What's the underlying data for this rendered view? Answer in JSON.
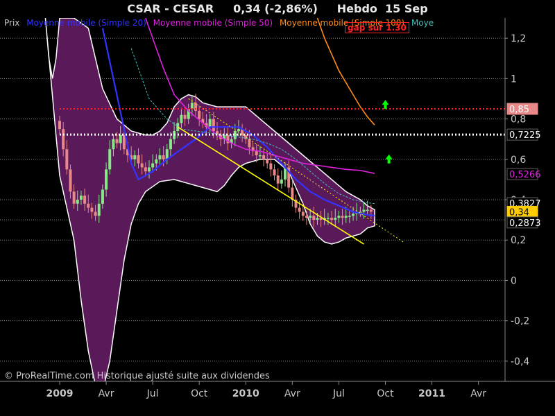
{
  "header": {
    "title": "CSAR - CESAR     0,34 (-2,86%)     Hebdo  15 Sep"
  },
  "legend": [
    {
      "label": "Prix",
      "color": "#c8c8c8"
    },
    {
      "label": "Moyenne mobile (Simple 20)",
      "color": "#3333ff"
    },
    {
      "label": "Moyenne mobile (Simple 50)",
      "color": "#dd22dd"
    },
    {
      "label": "Moyenne mobile (Simple 100)",
      "color": "#ff8c1a"
    },
    {
      "label": "Moye",
      "color": "#40c0c0"
    }
  ],
  "annotation": {
    "text": "gap sur 1.30",
    "color": "#ff2020"
  },
  "footer": {
    "text": "© ProRealTime.com Historique ajusté suite aux dividendes"
  },
  "colors": {
    "background": "#000000",
    "band_fill": "#5a1a5a",
    "band_edge": "#ffffff",
    "grid": "#8a8a8a",
    "axis_text": "#c8c8c8",
    "candle_up": "#88e888",
    "candle_down": "#e88888",
    "trend_line": "#ffff00",
    "resistance": "#ff2020",
    "support": "#ffffff",
    "arrow": "#00ff00"
  },
  "chart_data": {
    "type": "candlestick",
    "title": "CSAR - CESAR     0,34 (-2,86%)     Hebdo  15 Sep",
    "ylim": [
      -0.5,
      1.3
    ],
    "y_ticks": [
      "1,2",
      "1",
      "0,8",
      "0,6",
      "0,4",
      "0,2",
      "0",
      "-0,2",
      "-0,4"
    ],
    "y_tick_values": [
      1.2,
      1.0,
      0.8,
      0.6,
      0.4,
      0.2,
      0.0,
      -0.2,
      -0.4
    ],
    "x_ticks": [
      "2009",
      "Avr",
      "Jul",
      "Oct",
      "2010",
      "Avr",
      "Jul",
      "Oct",
      "2011",
      "Avr"
    ],
    "x_tick_bold": [
      true,
      false,
      false,
      false,
      true,
      false,
      false,
      false,
      true,
      false
    ],
    "x_range": [
      -4,
      116
    ],
    "x_tick_positions": [
      0,
      13,
      26,
      39,
      52,
      65,
      78,
      91,
      104,
      117
    ],
    "grid": true,
    "levels": [
      {
        "value": 0.85,
        "label": "0,85",
        "style": "dotted",
        "color": "#ff2020",
        "label_bg": "#e88888",
        "label_fg": "#ffffff"
      },
      {
        "value": 0.7225,
        "label": "0,7225",
        "style": "dotted",
        "color": "#ffffff",
        "label_bg": "#000000",
        "label_fg": "#ffffff"
      }
    ],
    "right_labels": [
      {
        "value": 0.5266,
        "label": "0,5266",
        "color": "#dd22dd",
        "bg": "#000000"
      },
      {
        "value": 0.3827,
        "label": "0,3827",
        "color": "#ffffff",
        "bg": "#000000"
      },
      {
        "value": 0.34,
        "label": "0,34",
        "color": "#000000",
        "bg": "#ffcc00"
      },
      {
        "value": 0.2873,
        "label": "0,2873",
        "color": "#ffffff",
        "bg": "#000000"
      }
    ],
    "close": [
      0.75,
      0.65,
      0.55,
      0.44,
      0.38,
      0.4,
      0.42,
      0.38,
      0.36,
      0.34,
      0.32,
      0.38,
      0.45,
      0.55,
      0.65,
      0.7,
      0.68,
      0.72,
      0.65,
      0.62,
      0.6,
      0.62,
      0.58,
      0.56,
      0.54,
      0.56,
      0.58,
      0.6,
      0.62,
      0.6,
      0.65,
      0.7,
      0.74,
      0.78,
      0.82,
      0.8,
      0.85,
      0.88,
      0.84,
      0.8,
      0.78,
      0.76,
      0.8,
      0.74,
      0.72,
      0.7,
      0.72,
      0.68,
      0.7,
      0.74,
      0.75,
      0.72,
      0.7,
      0.66,
      0.64,
      0.62,
      0.62,
      0.6,
      0.58,
      0.55,
      0.52,
      0.48,
      0.5,
      0.56,
      0.46,
      0.4,
      0.36,
      0.34,
      0.32,
      0.31,
      0.32,
      0.3,
      0.31,
      0.3,
      0.31,
      0.31,
      0.3,
      0.31,
      0.32,
      0.31,
      0.32,
      0.32,
      0.33,
      0.34,
      0.34,
      0.35,
      0.35,
      0.34
    ],
    "series": [
      {
        "name": "Moyenne mobile (Simple 20)",
        "color": "#3333ff",
        "points": [
          [
            12,
            1.25
          ],
          [
            15,
            1.0
          ],
          [
            18,
            0.75
          ],
          [
            20,
            0.58
          ],
          [
            22,
            0.5
          ],
          [
            26,
            0.54
          ],
          [
            30,
            0.6
          ],
          [
            34,
            0.65
          ],
          [
            38,
            0.7
          ],
          [
            42,
            0.76
          ],
          [
            46,
            0.76
          ],
          [
            50,
            0.76
          ],
          [
            54,
            0.72
          ],
          [
            58,
            0.66
          ],
          [
            62,
            0.58
          ],
          [
            66,
            0.5
          ],
          [
            70,
            0.44
          ],
          [
            74,
            0.4
          ],
          [
            78,
            0.37
          ],
          [
            82,
            0.34
          ],
          [
            86,
            0.325
          ],
          [
            88,
            0.32
          ]
        ]
      },
      {
        "name": "Moyenne mobile (Simple 50)",
        "color": "#dd22dd",
        "points": [
          [
            24,
            1.3
          ],
          [
            26,
            1.2
          ],
          [
            29,
            1.05
          ],
          [
            32,
            0.92
          ],
          [
            36,
            0.84
          ],
          [
            40,
            0.78
          ],
          [
            44,
            0.72
          ],
          [
            48,
            0.68
          ],
          [
            52,
            0.65
          ],
          [
            56,
            0.64
          ],
          [
            60,
            0.62
          ],
          [
            64,
            0.6
          ],
          [
            68,
            0.58
          ],
          [
            72,
            0.57
          ],
          [
            76,
            0.56
          ],
          [
            80,
            0.55
          ],
          [
            84,
            0.545
          ],
          [
            88,
            0.53
          ]
        ]
      },
      {
        "name": "Moyenne mobile (Simple 100)",
        "color": "#ff8c1a",
        "points": [
          [
            72,
            1.3
          ],
          [
            74,
            1.2
          ],
          [
            76,
            1.12
          ],
          [
            78,
            1.04
          ],
          [
            80,
            0.98
          ],
          [
            82,
            0.92
          ],
          [
            84,
            0.86
          ],
          [
            86,
            0.81
          ],
          [
            88,
            0.77
          ]
        ]
      },
      {
        "name": "Moye",
        "color": "#40c0c0",
        "points": [
          [
            20,
            1.15
          ],
          [
            25,
            0.9
          ],
          [
            30,
            0.8
          ],
          [
            34,
            0.75
          ],
          [
            38,
            0.74
          ],
          [
            42,
            0.73
          ],
          [
            46,
            0.72
          ],
          [
            50,
            0.71
          ],
          [
            54,
            0.7
          ],
          [
            58,
            0.68
          ],
          [
            62,
            0.65
          ],
          [
            66,
            0.6
          ],
          [
            70,
            0.54
          ],
          [
            74,
            0.48
          ],
          [
            78,
            0.43
          ],
          [
            82,
            0.4
          ],
          [
            86,
            0.385
          ],
          [
            88,
            0.38
          ]
        ]
      }
    ],
    "band_upper": [
      [
        -4,
        1.3
      ],
      [
        -3,
        1.1
      ],
      [
        -2,
        1.0
      ],
      [
        -1,
        1.1
      ],
      [
        0,
        1.3
      ],
      [
        4,
        1.3
      ],
      [
        8,
        1.25
      ],
      [
        12,
        0.95
      ],
      [
        16,
        0.8
      ],
      [
        20,
        0.74
      ],
      [
        24,
        0.72
      ],
      [
        26,
        0.72
      ],
      [
        28,
        0.74
      ],
      [
        30,
        0.78
      ],
      [
        32,
        0.86
      ],
      [
        34,
        0.9
      ],
      [
        36,
        0.92
      ],
      [
        38,
        0.91
      ],
      [
        40,
        0.88
      ],
      [
        44,
        0.86
      ],
      [
        48,
        0.86
      ],
      [
        52,
        0.86
      ],
      [
        56,
        0.8
      ],
      [
        60,
        0.74
      ],
      [
        64,
        0.68
      ],
      [
        68,
        0.62
      ],
      [
        72,
        0.56
      ],
      [
        76,
        0.5
      ],
      [
        80,
        0.44
      ],
      [
        84,
        0.4
      ],
      [
        86,
        0.37
      ],
      [
        88,
        0.35
      ]
    ],
    "band_lower": [
      [
        88,
        0.27
      ],
      [
        86,
        0.26
      ],
      [
        84,
        0.23
      ],
      [
        80,
        0.21
      ],
      [
        78,
        0.19
      ],
      [
        76,
        0.18
      ],
      [
        74,
        0.19
      ],
      [
        72,
        0.22
      ],
      [
        70,
        0.28
      ],
      [
        68,
        0.38
      ],
      [
        66,
        0.46
      ],
      [
        64,
        0.54
      ],
      [
        60,
        0.6
      ],
      [
        56,
        0.6
      ],
      [
        52,
        0.58
      ],
      [
        50,
        0.56
      ],
      [
        48,
        0.52
      ],
      [
        46,
        0.47
      ],
      [
        44,
        0.44
      ],
      [
        40,
        0.46
      ],
      [
        36,
        0.48
      ],
      [
        32,
        0.5
      ],
      [
        28,
        0.49
      ],
      [
        24,
        0.44
      ],
      [
        22,
        0.38
      ],
      [
        20,
        0.28
      ],
      [
        18,
        0.1
      ],
      [
        16,
        -0.15
      ],
      [
        14,
        -0.4
      ],
      [
        12,
        -0.55
      ],
      [
        10,
        -0.52
      ],
      [
        8,
        -0.35
      ],
      [
        6,
        -0.1
      ],
      [
        4,
        0.2
      ],
      [
        2,
        0.36
      ],
      [
        0,
        0.52
      ]
    ],
    "trend_line": [
      [
        33,
        0.76
      ],
      [
        85,
        0.18
      ]
    ],
    "resistance_diagonal": [
      [
        36,
        0.9
      ],
      [
        96,
        0.19
      ]
    ]
  }
}
